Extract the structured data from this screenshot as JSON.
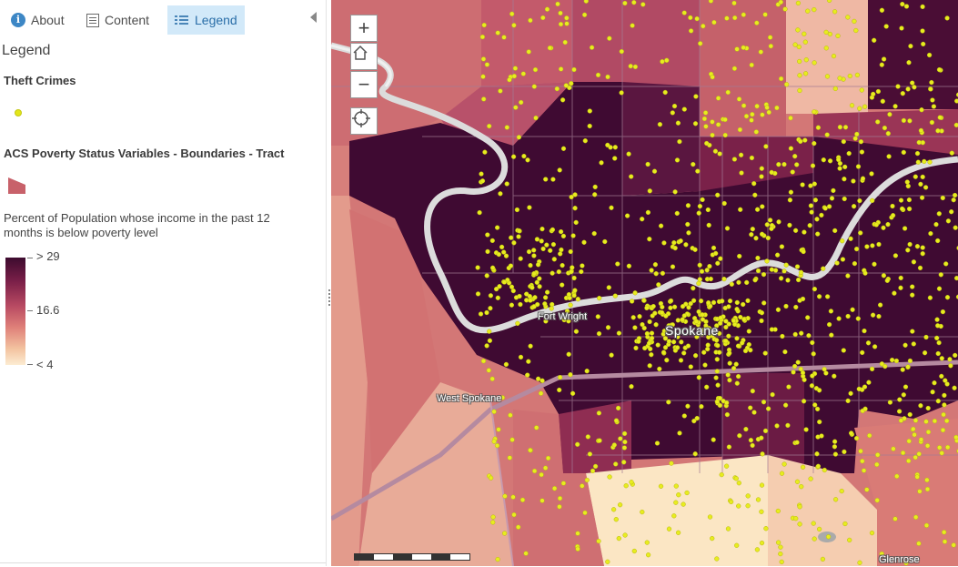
{
  "tabs": {
    "about": "About",
    "content": "Content",
    "legend": "Legend",
    "about_icon": "info-icon",
    "content_icon": "content-list-icon",
    "legend_icon": "legend-list-icon",
    "active": "legend"
  },
  "legend": {
    "heading": "Legend",
    "layers": [
      {
        "title": "Theft Crimes",
        "symbol": "yellow-point"
      },
      {
        "title": "ACS Poverty Status Variables - Boundaries - Tract",
        "symbol": "polygon-swatch",
        "field_description": "Percent of Population whose income in the past 12 months is below poverty level",
        "ramp_labels": {
          "high": "> 29",
          "mid": "16.6",
          "low": "< 4"
        },
        "ramp_colors": [
          "#3d0b2e",
          "#7a1f48",
          "#b84a62",
          "#df8079",
          "#f3c3a0",
          "#fcecd2"
        ]
      }
    ]
  },
  "map": {
    "labels": {
      "spokane": "Spokane",
      "fort_wright": "Fort Wright",
      "west_spokane": "West Spokane",
      "glenrose": "Glenrose"
    },
    "controls": {
      "zoom_in": "+",
      "zoom_out": "−",
      "home_icon": "home-icon",
      "locate_icon": "locate-icon"
    },
    "point_color": "#e8ec1f",
    "river_color": "#dcdcdc"
  }
}
